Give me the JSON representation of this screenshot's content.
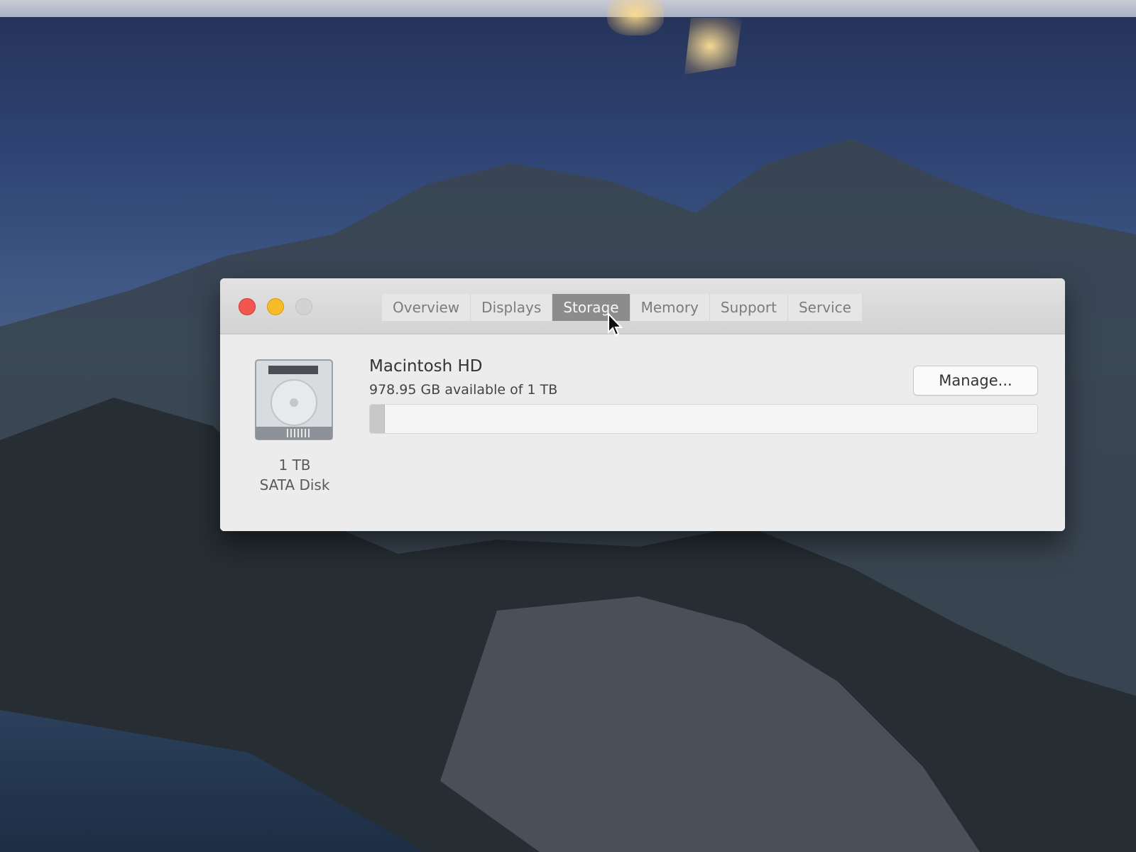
{
  "window": {
    "tabs": [
      {
        "label": "Overview"
      },
      {
        "label": "Displays"
      },
      {
        "label": "Storage"
      },
      {
        "label": "Memory"
      },
      {
        "label": "Support"
      },
      {
        "label": "Service"
      }
    ],
    "active_tab": "Storage"
  },
  "disk": {
    "icon": "hard-drive-icon",
    "size": "1 TB",
    "type": "SATA Disk"
  },
  "volume": {
    "name": "Macintosh HD",
    "available": "978.95 GB available of 1 TB",
    "used_fraction": 0.021
  },
  "buttons": {
    "manage_label": "Manage..."
  },
  "colors": {
    "close": "#f25650",
    "minimize": "#f7bb2a",
    "active_tab": "#8c8c8c"
  }
}
